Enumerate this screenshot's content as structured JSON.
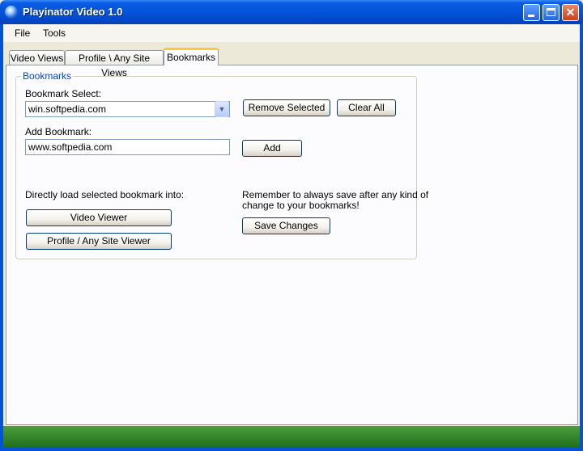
{
  "window": {
    "title": "Playinator Video 1.0"
  },
  "menu": {
    "file": "File",
    "tools": "Tools"
  },
  "tabs": [
    {
      "label": "Video Views"
    },
    {
      "label": "Profile \\ Any Site Views"
    },
    {
      "label": "Bookmarks"
    }
  ],
  "bookmarks": {
    "group_title": "Bookmarks",
    "select_label": "Bookmark Select:",
    "select_value": "win.softpedia.com",
    "add_label": "Add Bookmark:",
    "add_value": "www.softpedia.com",
    "remove_selected": "Remove Selected",
    "clear_all": "Clear All",
    "add_button": "Add",
    "load_note": "Directly load selected bookmark into:",
    "video_viewer": "Video Viewer",
    "profile_viewer": "Profile / Any Site Viewer",
    "save_note_line1": "Remember to always save after any kind of",
    "save_note_line2": "change to your bookmarks!",
    "save_changes": "Save Changes"
  },
  "colors": {
    "titlebar": "#0453d8",
    "statusbar": "#2f8a2a",
    "group_title": "#0046d5",
    "active_tab_accent": "#ffc83c"
  }
}
